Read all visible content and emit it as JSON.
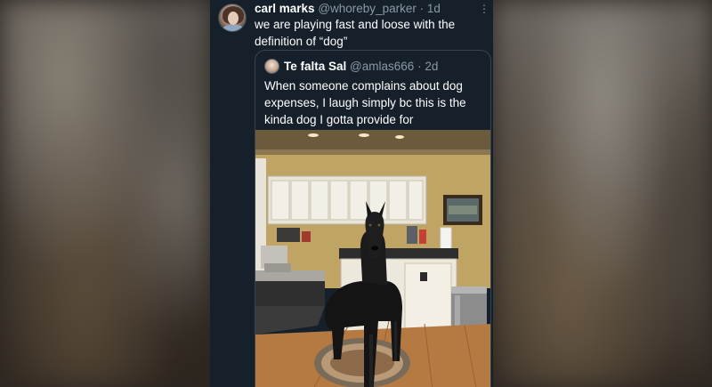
{
  "tweet": {
    "author_name": "carl marks",
    "author_handle": "@whoreby_parker",
    "separator": "·",
    "time": "1d",
    "text": "we are playing fast and loose with the definition of “dog”"
  },
  "quoted_tweet": {
    "author_name": "Te falta Sal",
    "author_handle": "@amlas666",
    "separator": "·",
    "time": "2d",
    "text": "When someone complains about dog expenses, I laugh simply bc this is the kinda dog I gotta provide for"
  },
  "icons": {
    "more": "more-vertical-icon"
  },
  "colors": {
    "tweet_background": "#15202b",
    "secondary_text": "#8b98a5",
    "primary_text": "#ffffff",
    "quote_border": "#38444d"
  }
}
